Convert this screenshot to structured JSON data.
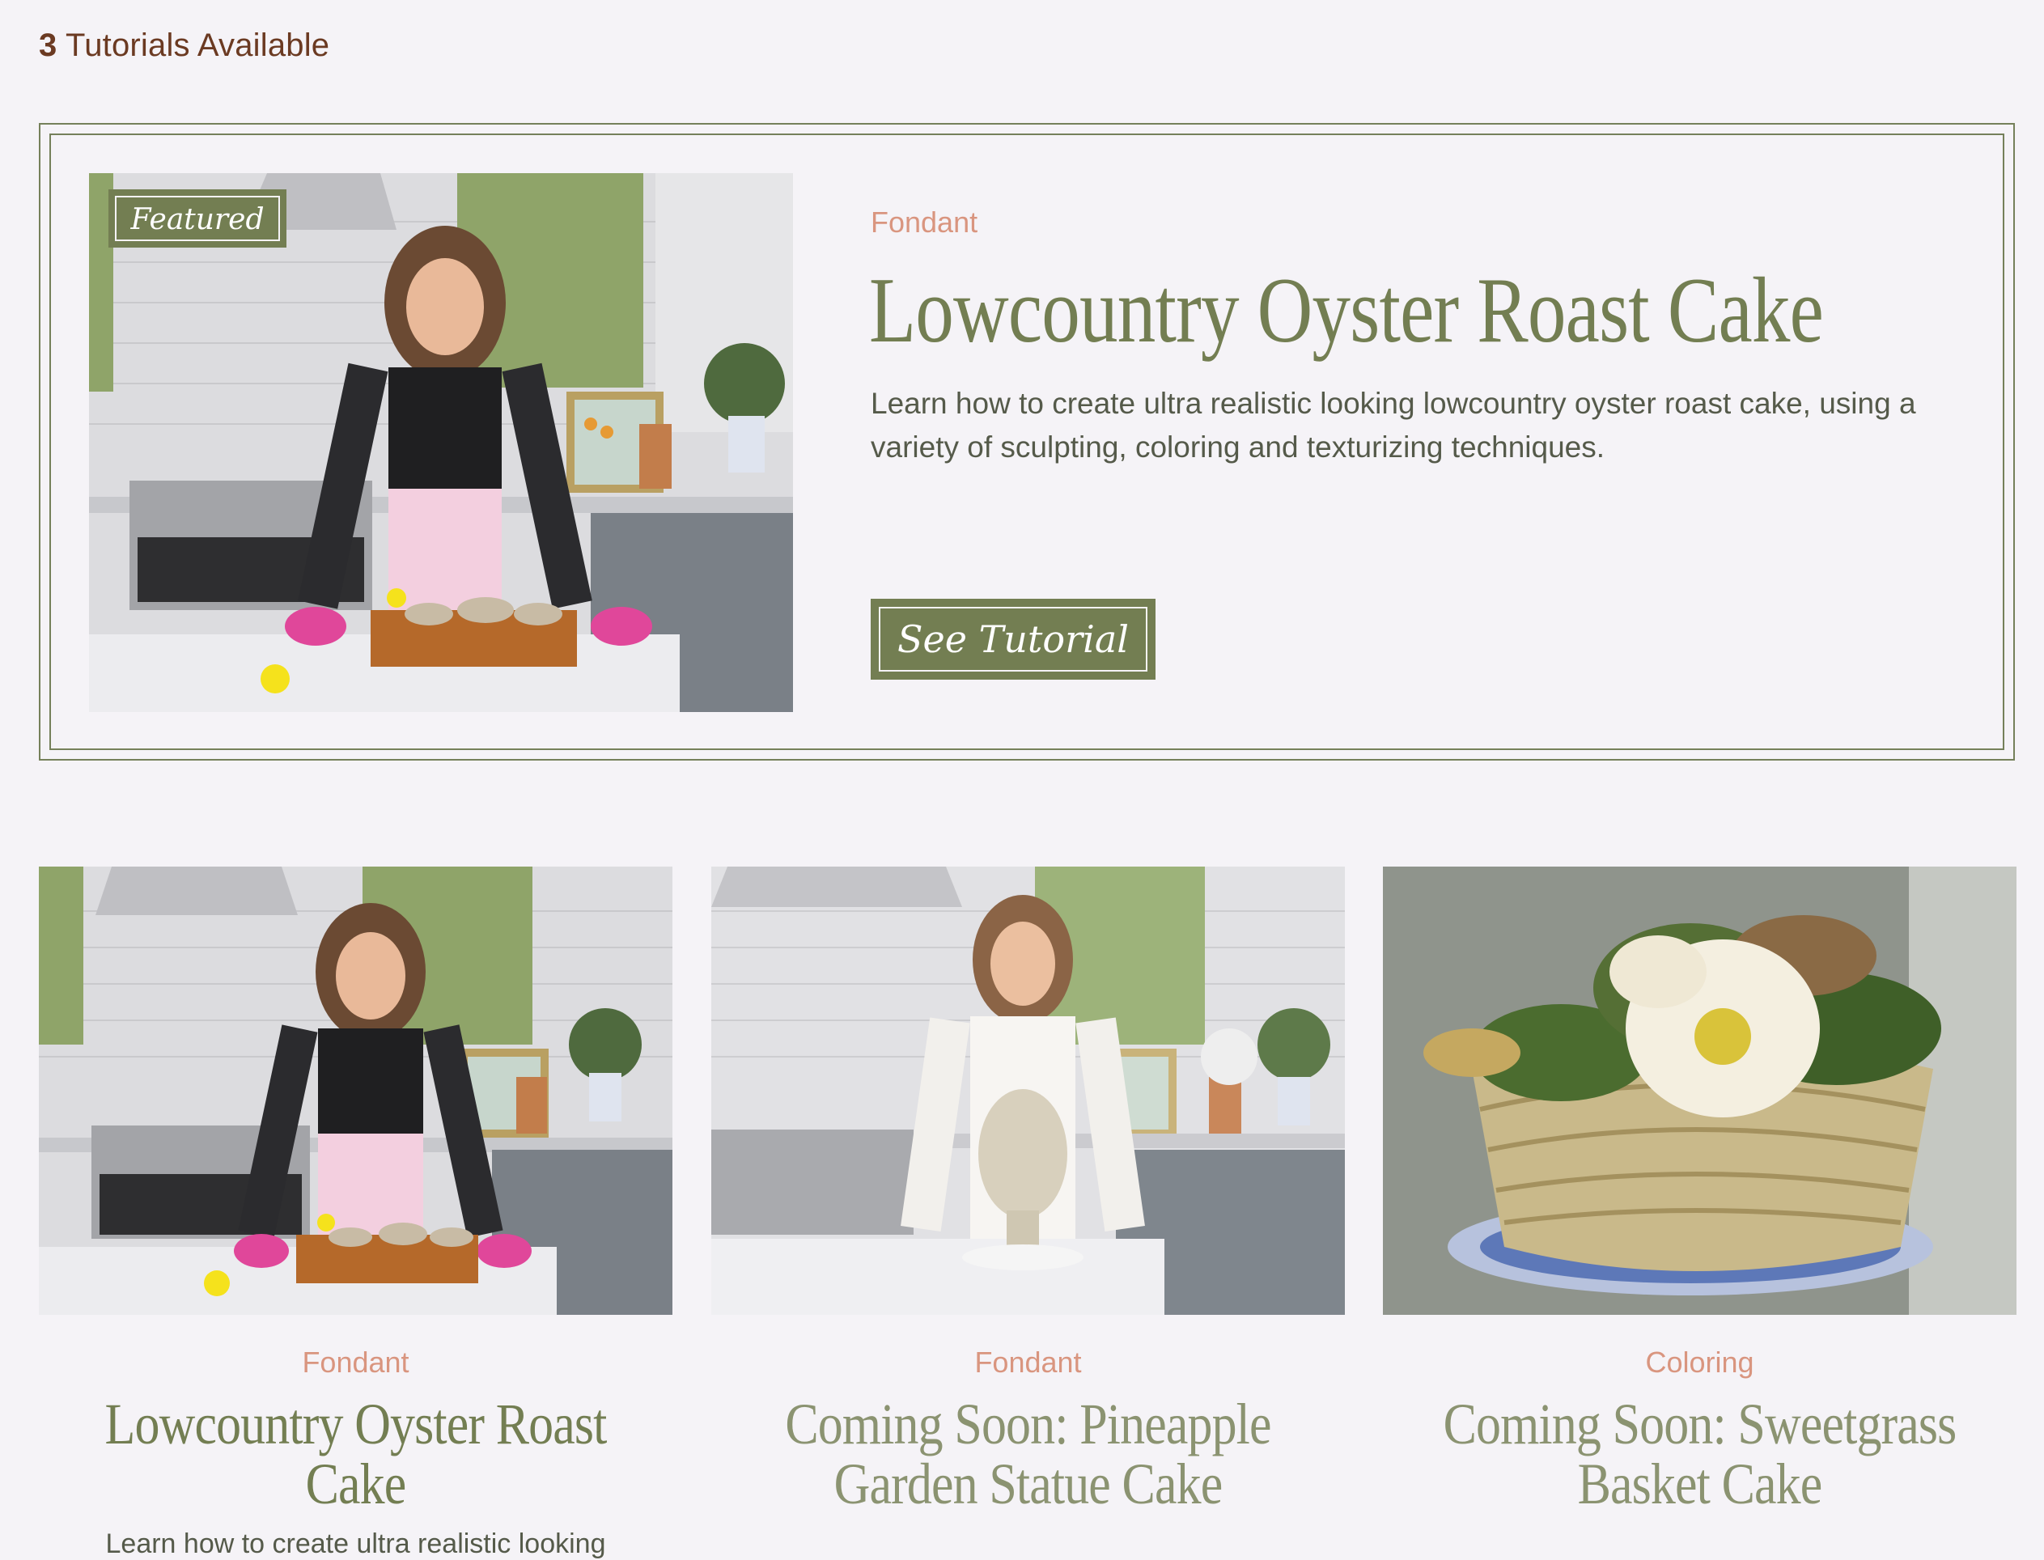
{
  "header": {
    "count": "3",
    "count_label": "Tutorials Available"
  },
  "featured": {
    "tag": "Featured",
    "category": "Fondant",
    "title": "Lowcountry Oyster Roast Cake",
    "description": "Learn how to create ultra realistic looking lowcountry oyster roast cake, using a variety of sculpting, coloring and texturizing techniques.",
    "button_label": "See Tutorial"
  },
  "cards": [
    {
      "category": "Fondant",
      "title": "Lowcountry Oyster Roast Cake",
      "description": "Learn how to create ultra realistic looking"
    },
    {
      "category": "Fondant",
      "title": "Coming Soon: Pineapple Garden Statue Cake"
    },
    {
      "category": "Coloring",
      "title": "Coming Soon: Sweetgrass Basket Cake"
    }
  ],
  "colors": {
    "accent_green": "#737e52",
    "category_salmon": "#d9957f",
    "count_brown": "#6b3a22",
    "background": "#f5f3f7"
  }
}
